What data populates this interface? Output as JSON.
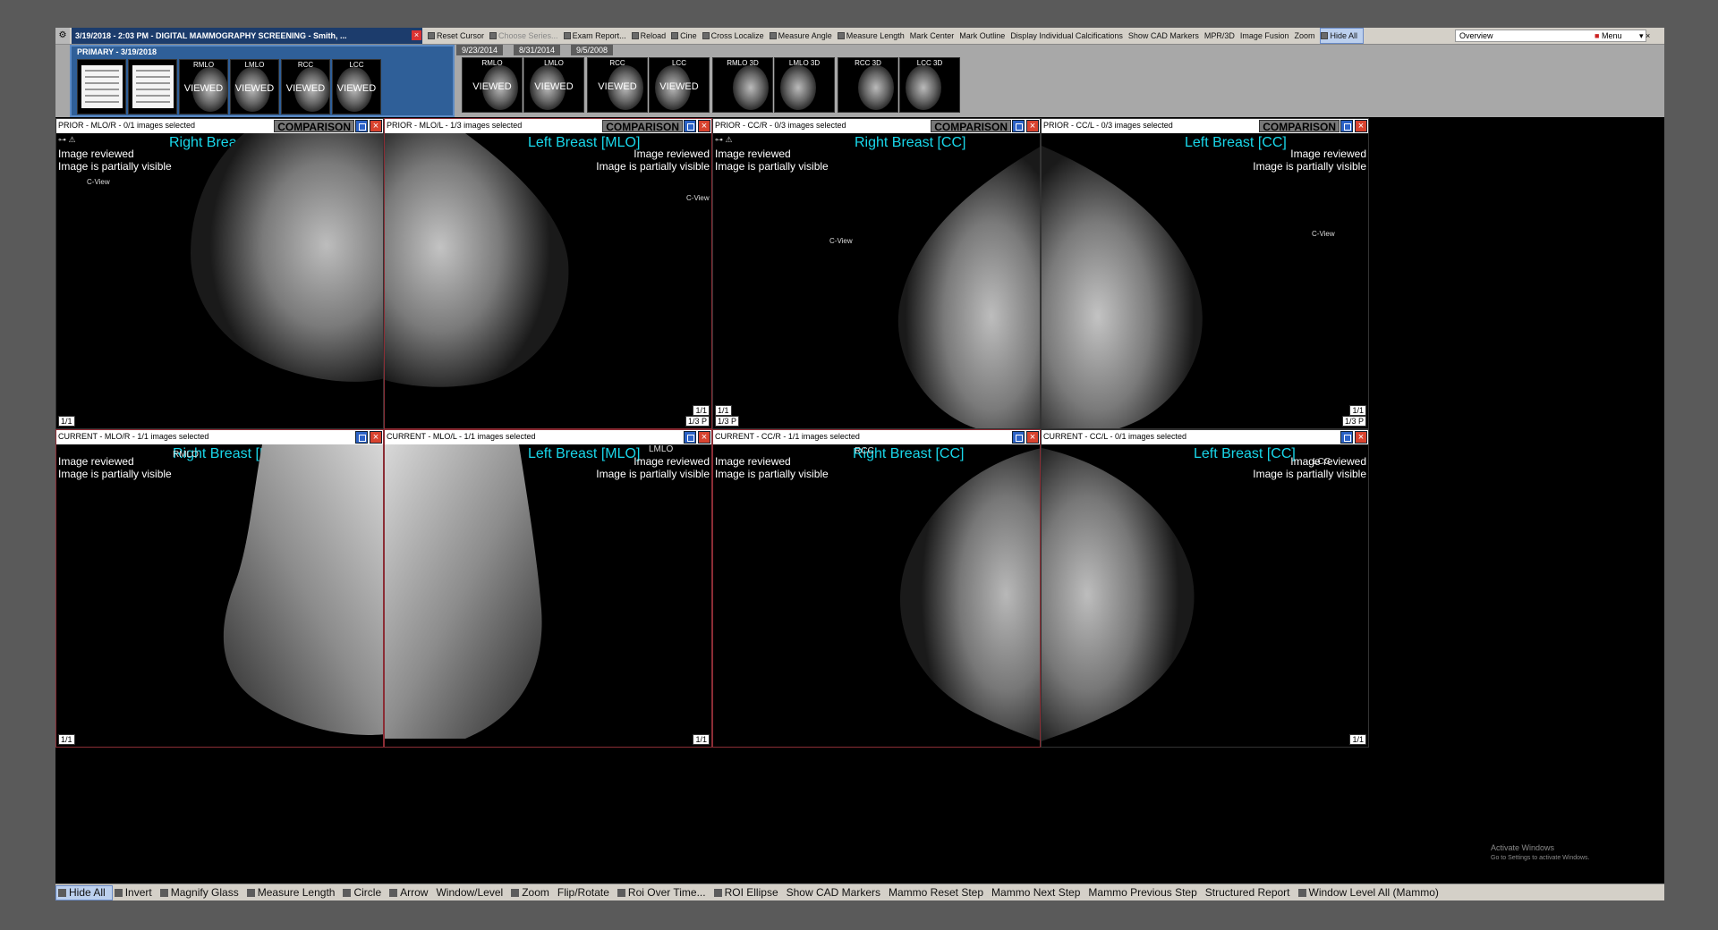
{
  "window": {
    "study_title": "3/19/2018 - 2:03 PM - DIGITAL MAMMOGRAPHY SCREENING - Smith, ...",
    "system_icon": "settings-gear-icon",
    "overview": "Overview",
    "menu_label": "Menu",
    "window_controls": "▾  ×"
  },
  "top_toolbar": [
    {
      "label": "Reset Cursor",
      "icon": "reset-cursor-icon",
      "state": "normal"
    },
    {
      "label": "Choose Series...",
      "icon": "choose-series-icon",
      "state": "disabled"
    },
    {
      "label": "Exam Report...",
      "icon": "exam-report-icon",
      "state": "normal"
    },
    {
      "label": "Reload",
      "icon": "reload-icon",
      "state": "normal"
    },
    {
      "label": "Cine",
      "icon": "cine-icon",
      "state": "normal"
    },
    {
      "label": "Cross Localize",
      "icon": "cross-localize-icon",
      "state": "normal"
    },
    {
      "label": "Measure Angle",
      "icon": "measure-angle-icon",
      "state": "normal"
    },
    {
      "label": "Measure Length",
      "icon": "measure-length-icon",
      "state": "normal"
    },
    {
      "label": "Mark Center",
      "icon": "",
      "state": "normal"
    },
    {
      "label": "Mark Outline",
      "icon": "",
      "state": "normal"
    },
    {
      "label": "Display Individual Calcifications",
      "icon": "",
      "state": "normal"
    },
    {
      "label": "Show CAD Markers",
      "icon": "",
      "state": "normal"
    },
    {
      "label": "MPR/3D",
      "icon": "",
      "state": "normal"
    },
    {
      "label": "Image Fusion",
      "icon": "",
      "state": "normal"
    },
    {
      "label": "Zoom",
      "icon": "",
      "state": "normal"
    },
    {
      "label": "Hide All",
      "icon": "hide-all-icon",
      "state": "active"
    }
  ],
  "thumbnails": {
    "primary_label": "PRIMARY - 3/19/2018",
    "primary_items": [
      {
        "label": "",
        "status": "",
        "kind": "report-document"
      },
      {
        "label": "",
        "status": "",
        "kind": "report-document"
      },
      {
        "label": "RMLO",
        "status": "VIEWED",
        "kind": "mammogram"
      },
      {
        "label": "LMLO",
        "status": "VIEWED",
        "kind": "mammogram"
      },
      {
        "label": "RCC",
        "status": "VIEWED",
        "kind": "mammogram"
      },
      {
        "label": "LCC",
        "status": "VIEWED",
        "kind": "mammogram"
      }
    ],
    "prior_dates": [
      "9/23/2014",
      "8/31/2014",
      "9/5/2008"
    ],
    "prior_items": [
      {
        "label": "RMLO",
        "status": "VIEWED"
      },
      {
        "label": "LMLO",
        "status": "VIEWED"
      },
      {
        "label": "RCC",
        "status": "VIEWED"
      },
      {
        "label": "LCC",
        "status": "VIEWED"
      },
      {
        "label": "RMLO 3D",
        "status": ""
      },
      {
        "label": "LMLO 3D",
        "status": ""
      },
      {
        "label": "RCC 3D",
        "status": ""
      },
      {
        "label": "LCC 3D",
        "status": ""
      }
    ]
  },
  "viewports": {
    "prior_mlo_r": {
      "header": "PRIOR - MLO/R - 0/1 images selected",
      "comparison": "COMPARISON",
      "title": "Right Breast [MLO]",
      "status1": "Image reviewed",
      "status2": "Image is partially visible",
      "cview": "C-View",
      "count": "1/1"
    },
    "prior_mlo_l": {
      "header": "PRIOR - MLO/L - 1/3 images selected",
      "comparison": "COMPARISON",
      "title": "Left Breast [MLO]",
      "status1": "Image reviewed",
      "status2": "Image is partially visible",
      "cview": "C-View",
      "count": "1/1",
      "count2": "1/3 P"
    },
    "prior_cc_r": {
      "header": "PRIOR - CC/R - 0/3 images selected",
      "comparison": "COMPARISON",
      "title": "Right Breast [CC]",
      "status1": "Image reviewed",
      "status2": "Image is partially visible",
      "cview": "C-View",
      "count": "1/1",
      "count2": "1/3 P"
    },
    "prior_cc_l": {
      "header": "PRIOR - CC/L - 0/3 images selected",
      "comparison": "COMPARISON",
      "title": "Left Breast [CC]",
      "status1": "Image reviewed",
      "status2": "Image is partially visible",
      "cview": "C-View",
      "count": "1/1",
      "count2": "1/3 P"
    },
    "current_mlo_r": {
      "header": "CURRENT - MLO/R - 1/1 images selected",
      "title": "Right Breast [MLO]",
      "status1": "Image reviewed",
      "status2": "Image is partially visible",
      "tag": "RMLO",
      "count": "1/1"
    },
    "current_mlo_l": {
      "header": "CURRENT - MLO/L - 1/1 images selected",
      "title": "Left Breast [MLO]",
      "status1": "Image reviewed",
      "status2": "Image is partially visible",
      "tag": "LMLO",
      "count": "1/1"
    },
    "current_cc_r": {
      "header": "CURRENT - CC/R - 1/1 images selected",
      "title": "Right Breast [CC]",
      "status1": "Image reviewed",
      "status2": "Image is partially visible",
      "tag": "RCC"
    },
    "current_cc_l": {
      "header": "CURRENT - CC/L - 0/1 images selected",
      "title": "Left Breast [CC]",
      "status1": "Image reviewed",
      "status2": "Image is partially visible",
      "tag": "LCC",
      "count": "1/1"
    }
  },
  "watermark": {
    "line1": "Activate Windows",
    "line2": "Go to Settings to activate Windows."
  },
  "bottom_toolbar": [
    {
      "label": "Hide All",
      "icon": "hide-all-icon",
      "state": "active"
    },
    {
      "label": "Invert",
      "icon": "invert-icon",
      "state": "normal"
    },
    {
      "label": "Magnify Glass",
      "icon": "magnify-icon",
      "state": "normal"
    },
    {
      "label": "Measure Length",
      "icon": "measure-length-icon",
      "state": "normal"
    },
    {
      "label": "Circle",
      "icon": "circle-icon",
      "state": "normal"
    },
    {
      "label": "Arrow",
      "icon": "arrow-icon",
      "state": "normal"
    },
    {
      "label": "Window/Level",
      "icon": "",
      "state": "normal"
    },
    {
      "label": "Zoom",
      "icon": "zoom-icon",
      "state": "normal"
    },
    {
      "label": "Flip/Rotate",
      "icon": "",
      "state": "normal"
    },
    {
      "label": "Roi Over Time...",
      "icon": "roi-time-icon",
      "state": "normal"
    },
    {
      "label": "ROI Ellipse",
      "icon": "roi-ellipse-icon",
      "state": "normal"
    },
    {
      "label": "Show CAD Markers",
      "icon": "",
      "state": "normal"
    },
    {
      "label": "Mammo Reset Step",
      "icon": "",
      "state": "normal"
    },
    {
      "label": "Mammo Next Step",
      "icon": "",
      "state": "normal"
    },
    {
      "label": "Mammo Previous Step",
      "icon": "",
      "state": "normal"
    },
    {
      "label": "Structured Report",
      "icon": "",
      "state": "normal"
    },
    {
      "label": "Window Level All (Mammo)",
      "icon": "window-level-icon",
      "state": "normal"
    }
  ]
}
